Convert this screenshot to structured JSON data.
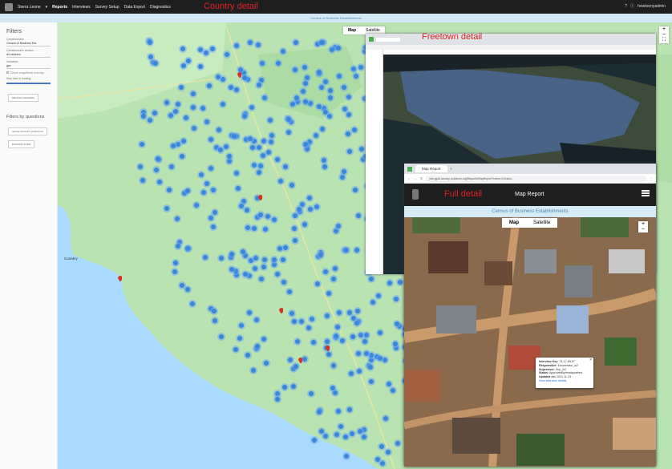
{
  "topbar": {
    "brand": "Sierra Leone",
    "nav": [
      "Reports",
      "Interviews",
      "Survey Setup",
      "Data Export",
      "Diagnostics"
    ],
    "user": "howtoenyadmin"
  },
  "annotations": {
    "country": "Country detail",
    "freetown": "Freetown detail",
    "full": "Full detail"
  },
  "subheader": "Census of Business Establishments",
  "filters": {
    "title": "Filters",
    "questionnaire_label": "Questionnaire",
    "questionnaire_value": "Census of Business Est.",
    "version_label": "Questionnaire version",
    "version_value": "All versions",
    "variable_label": "Variables",
    "variable_value": "gps",
    "show_label": "Show map/heat overlay",
    "loading_label": "Map data is loading",
    "reload_button": "RELOAD MARKERS",
    "by_questions": "Filters by questions",
    "btn1": "SHOW DATA BY QUESTION",
    "btn2": "EXPAND FILTER"
  },
  "map": {
    "tab_map": "Map",
    "tab_satellite": "Satellite",
    "place_label": "Conakry",
    "zoom_in": "+",
    "zoom_out": "−"
  },
  "window2": {
    "tab_title": "Map Report",
    "url": "cbe.gps1.survey-solutions.org/Reports/MapReport?name=Census...",
    "app_title": "Map Report",
    "census": "Census of Business Establishments",
    "tab_map": "Map",
    "tab_satellite": "Satellite"
  },
  "popup": {
    "lines": [
      {
        "k": "Interview Key:",
        "v": "74-17-65-57"
      },
      {
        "k": "Responsible:",
        "v": "Enumerator_ls2"
      },
      {
        "k": "Supervisor:",
        "v": "Sup_ls2"
      },
      {
        "k": "Status:",
        "v": "ApprovedByHeadquarters"
      },
      {
        "k": "Updated on:",
        "v": "2021-11-23"
      },
      {
        "k": "View interview details",
        "v": ""
      }
    ]
  },
  "colors": {
    "land": "#b7e3b0",
    "water": "#aadaff",
    "cluster": "#3a86d9",
    "pin": "#d93025",
    "annotation": "#e02020"
  }
}
